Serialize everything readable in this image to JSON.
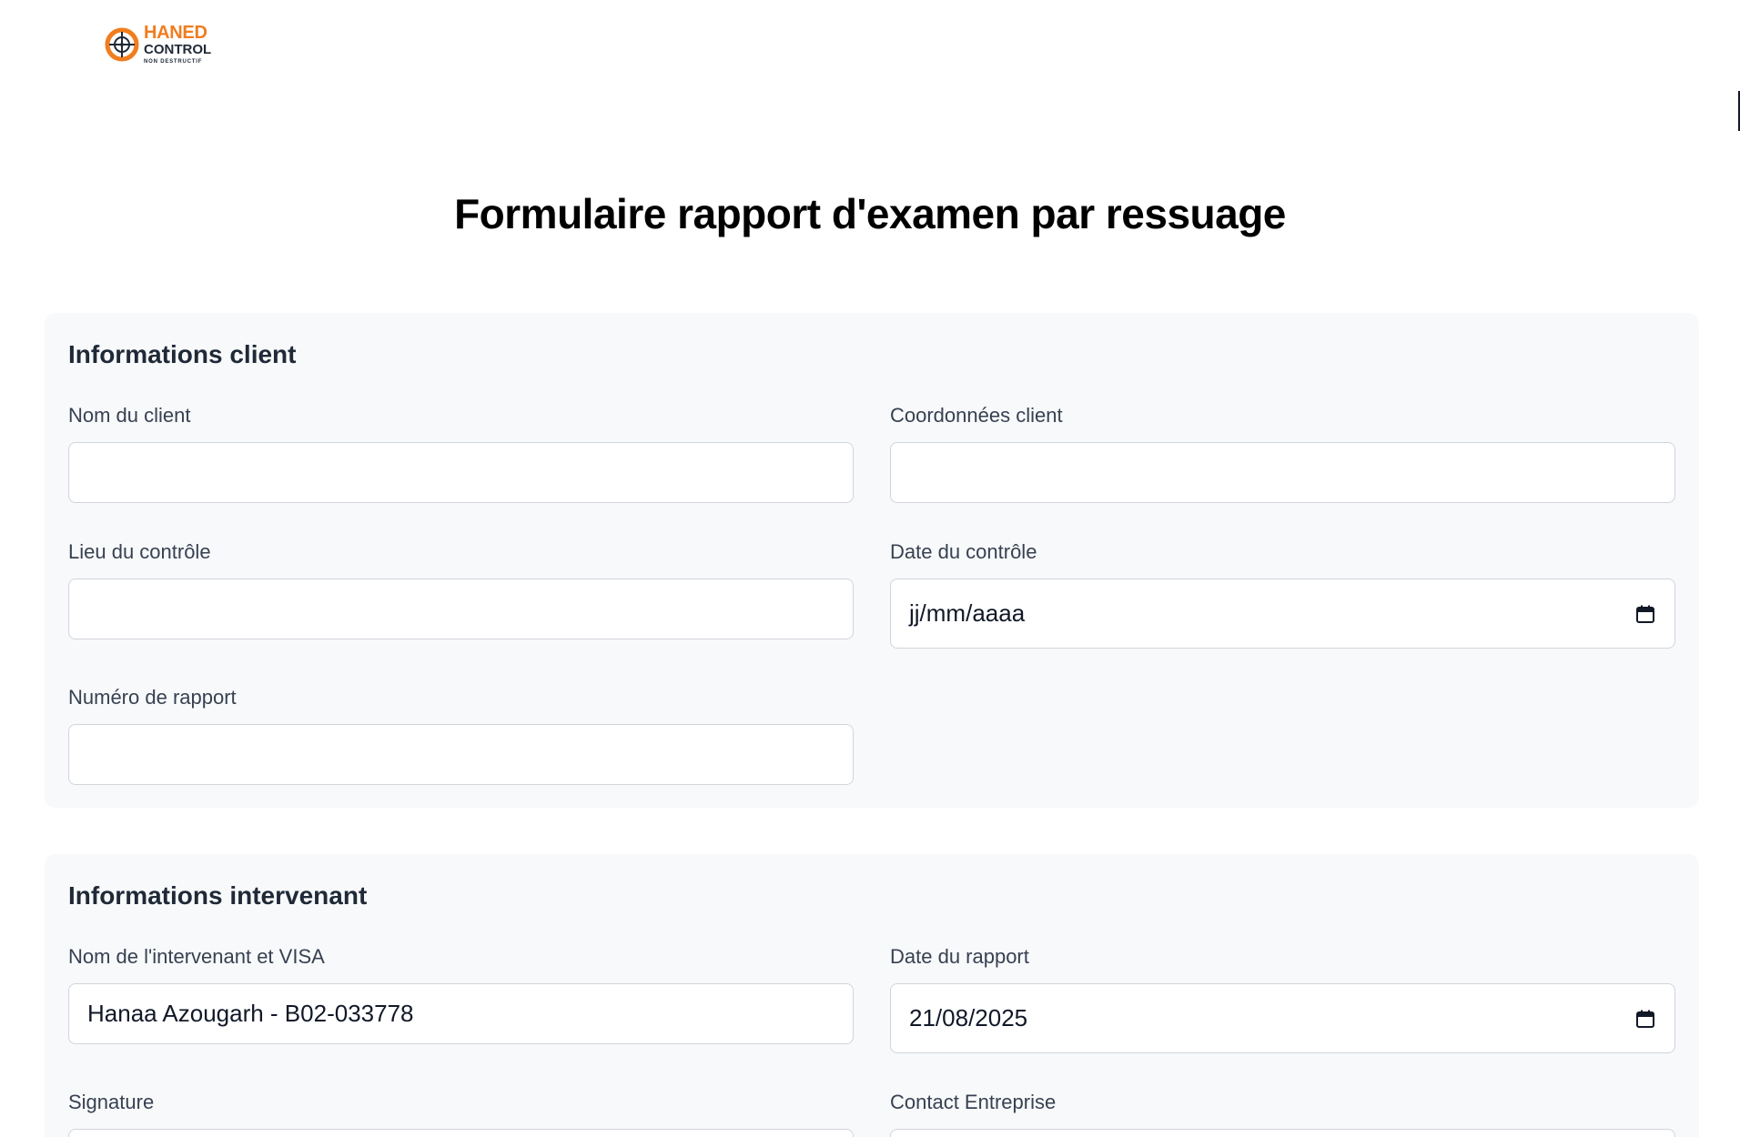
{
  "logo": {
    "line1": "HANED",
    "line2": "CONTROL",
    "line3": "NON DESTRUCTIF",
    "colors": {
      "orange": "#f07d1e",
      "dark": "#1f2937"
    }
  },
  "page_title": "Formulaire rapport d'examen par ressuage",
  "client_section": {
    "title": "Informations client",
    "nom_client": {
      "label": "Nom du client",
      "value": ""
    },
    "coordonnees_client": {
      "label": "Coordonnées client",
      "value": ""
    },
    "lieu_controle": {
      "label": "Lieu du contrôle",
      "value": ""
    },
    "date_controle": {
      "label": "Date du contrôle",
      "value": "jj/mm/aaaa",
      "icon": "calendar-icon"
    },
    "numero_rapport": {
      "label": "Numéro de rapport",
      "value": ""
    }
  },
  "intervenant_section": {
    "title": "Informations intervenant",
    "nom_intervenant": {
      "label": "Nom de l'intervenant et VISA",
      "value": "Hanaa Azougarh - B02-033778"
    },
    "date_rapport": {
      "label": "Date du rapport",
      "value": "21/08/2025",
      "icon": "calendar-icon"
    },
    "signature": {
      "label": "Signature",
      "value": ""
    },
    "contact_entreprise": {
      "label": "Contact Entreprise",
      "value": ""
    }
  }
}
